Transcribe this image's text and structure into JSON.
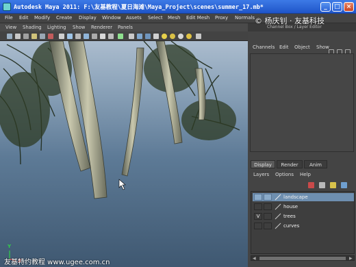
{
  "window": {
    "title": "Autodesk Maya 2011: F:\\友基教程\\夏日海滩\\Maya_Project\\scenes\\summer_17.mb*",
    "controls": [
      "_",
      "□",
      "×"
    ]
  },
  "menubar": {
    "items": [
      "File",
      "Edit",
      "Modify",
      "Create",
      "Display",
      "Window",
      "Assets",
      "Select",
      "Mesh",
      "Edit Mesh",
      "Proxy",
      "Normals"
    ]
  },
  "viewport": {
    "menu": [
      "View",
      "Shading",
      "Lighting",
      "Show",
      "Renderer",
      "Panels"
    ],
    "axis": {
      "y": "Y",
      "x": "X"
    },
    "watermark": "友基特约教程  www.ugee.com.cn"
  },
  "channel_box": {
    "title": "Channel Box / Layer Editor",
    "menu": [
      "Channels",
      "Edit",
      "Object",
      "Show"
    ]
  },
  "overlay_watermark": "© 杨庆钊 · 友基科技",
  "layer_editor": {
    "tabs": [
      "Display",
      "Render",
      "Anim"
    ],
    "active_tab": "Display",
    "menu": [
      "Layers",
      "Options",
      "Help"
    ],
    "layers": [
      {
        "name": "landscape",
        "visible": "",
        "selected": true
      },
      {
        "name": "house",
        "visible": "",
        "selected": false
      },
      {
        "name": "trees",
        "visible": "V",
        "selected": false
      },
      {
        "name": "curves",
        "visible": "",
        "selected": false
      }
    ]
  },
  "colors": {
    "titlebar": "#1f55c9",
    "selected_layer": "#6e8fb0",
    "ui_panel": "#444444"
  }
}
